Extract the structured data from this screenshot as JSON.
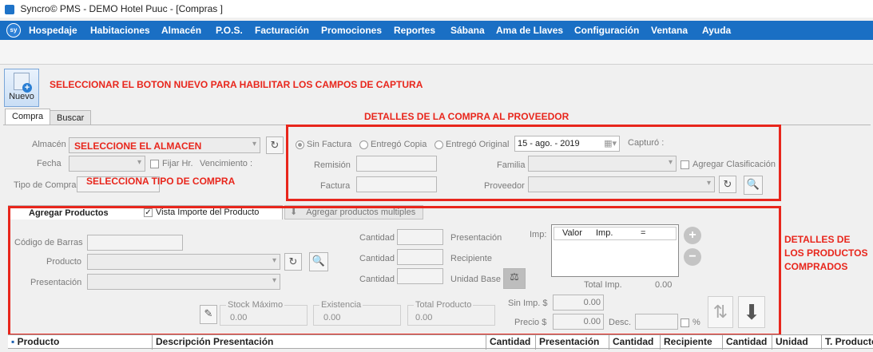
{
  "window": {
    "title": "Syncro© PMS - DEMO Hotel Puuc - [Compras ]"
  },
  "menu": {
    "logo": "sy",
    "items": [
      "Hospedaje",
      "Habitaciones",
      "Almacén",
      "P.O.S.",
      "Facturación",
      "Promociones",
      "Reportes",
      "Sábana",
      "Ama de Llaves",
      "Configuración",
      "Ventana",
      "Ayuda"
    ]
  },
  "toolbar": {
    "nuevo_label": "Nuevo"
  },
  "annotations": {
    "nuevo_hint": "SELECCIONAR EL BOTON NUEVO PARA HABILITAR LOS CAMPOS DE CAPTURA",
    "detalles_compra": "DETALLES DE LA COMPRA AL PROVEEDOR",
    "almacen_hint": "SELECCIONE EL ALMACEN",
    "tipo_hint": "SELECCIONA TIPO DE COMPRA",
    "detalles_productos": "DETALLES DE LOS PRODUCTOS COMPRADOS"
  },
  "tabs": {
    "compra": "Compra",
    "buscar": "Buscar"
  },
  "form": {
    "almacen_label": "Almacén",
    "fecha_label": "Fecha",
    "fijar_hr_label": "Fijar Hr.",
    "vencimiento_label": "Vencimiento :",
    "tipo_compra_label": "Tipo de Compra",
    "sin_factura": "Sin Factura",
    "entrego_copia": "Entregó Copia",
    "entrego_original": "Entregó Original",
    "date_value": "15 - ago. - 2019",
    "capturo_label": "Capturó :",
    "remision_label": "Remisión",
    "familia_label": "Familia",
    "agregar_clasificacion": "Agregar Clasificación",
    "factura_label": "Factura",
    "proveedor_label": "Proveedor"
  },
  "products": {
    "tab_agregar": "Agregar Productos",
    "vista_importe": "Vista Importe del Producto",
    "agregar_multiples": "Agregar productos multiples",
    "codigo_label": "Código de Barras",
    "producto_label": "Producto",
    "presentacion_label": "Presentación",
    "cantidad_label": "Cantidad",
    "presentacion_right": "Presentación",
    "recipiente_label": "Recipiente",
    "unidad_base_label": "Unidad Base",
    "imp_label": "Imp:",
    "imp_cols": [
      "Valor",
      "Imp.",
      "="
    ],
    "total_imp_label": "Total Imp.",
    "total_imp_value": "0.00",
    "stock_max_label": "Stock Máximo",
    "stock_max_value": "0.00",
    "existencia_label": "Existencia",
    "existencia_value": "0.00",
    "total_producto_label": "Total Producto",
    "total_producto_value": "0.00",
    "sin_imp_label": "Sin Imp. $",
    "sin_imp_value": "0.00",
    "precio_label": "Precio $",
    "precio_value": "0.00",
    "desc_label": "Desc.",
    "pct_label": "%"
  },
  "grid": {
    "columns": [
      "Producto",
      "Descripción Presentación",
      "Cantidad",
      "Presentación",
      "Cantidad",
      "Recipiente",
      "Cantidad",
      "Unidad",
      "T. Producto"
    ]
  },
  "colors": {
    "menu_bg": "#1a6fc4",
    "annotation_red": "#e8261c"
  }
}
